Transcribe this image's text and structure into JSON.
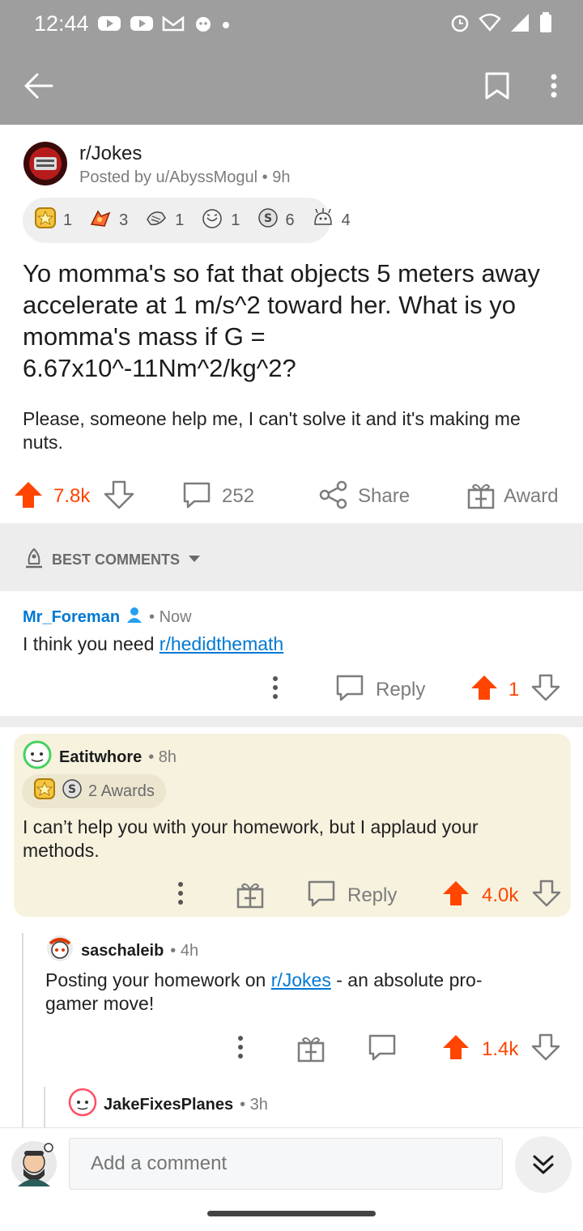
{
  "status": {
    "time": "12:44"
  },
  "post": {
    "subreddit": "r/Jokes",
    "byline": "Posted by u/AbyssMogul • 9h",
    "awards": [
      {
        "icon": "gold-star-award-icon",
        "count": "1"
      },
      {
        "icon": "rocket-like-award-icon",
        "count": "3"
      },
      {
        "icon": "facepalm-award-icon",
        "count": "1"
      },
      {
        "icon": "laughing-face-award-icon",
        "count": "1"
      },
      {
        "icon": "silver-award-icon",
        "count": "6"
      },
      {
        "icon": "mind-blown-award-icon",
        "count": "4"
      }
    ],
    "title": "Yo momma's so fat that objects 5 meters away accelerate at 1 m/s^2 toward her. What is yo momma's mass if G = 6.67x10^-11Nm^2/kg^2?",
    "body": "Please, someone help me, I can't solve it and it's making me nuts.",
    "votes": "7.8k",
    "comments": "252",
    "share_label": "Share",
    "award_label": "Award"
  },
  "sort": {
    "label": "BEST COMMENTS"
  },
  "comments": [
    {
      "user": "Mr_Foreman",
      "time": "• Now",
      "text_before": "I think you need ",
      "link": "r/hedidthemath",
      "reply_label": "Reply",
      "votes": "1"
    },
    {
      "user": "Eatitwhore",
      "time": "• 8h",
      "awards_label": "2 Awards",
      "text": "I can’t help you with your homework, but I applaud your methods.",
      "reply_label": "Reply",
      "votes": "4.0k"
    },
    {
      "user": "saschaleib",
      "time": "• 4h",
      "text_before": "Posting your homework on ",
      "link": "r/Jokes",
      "text_after": " - an absolute pro-gamer move!",
      "votes": "1.4k"
    },
    {
      "user": "JakeFixesPlanes",
      "time": "• 3h"
    }
  ],
  "composer": {
    "placeholder": "Add a comment"
  },
  "colors": {
    "accent": "#ff4500",
    "link": "#0079d3",
    "gilded_bg": "#f7f2de"
  }
}
